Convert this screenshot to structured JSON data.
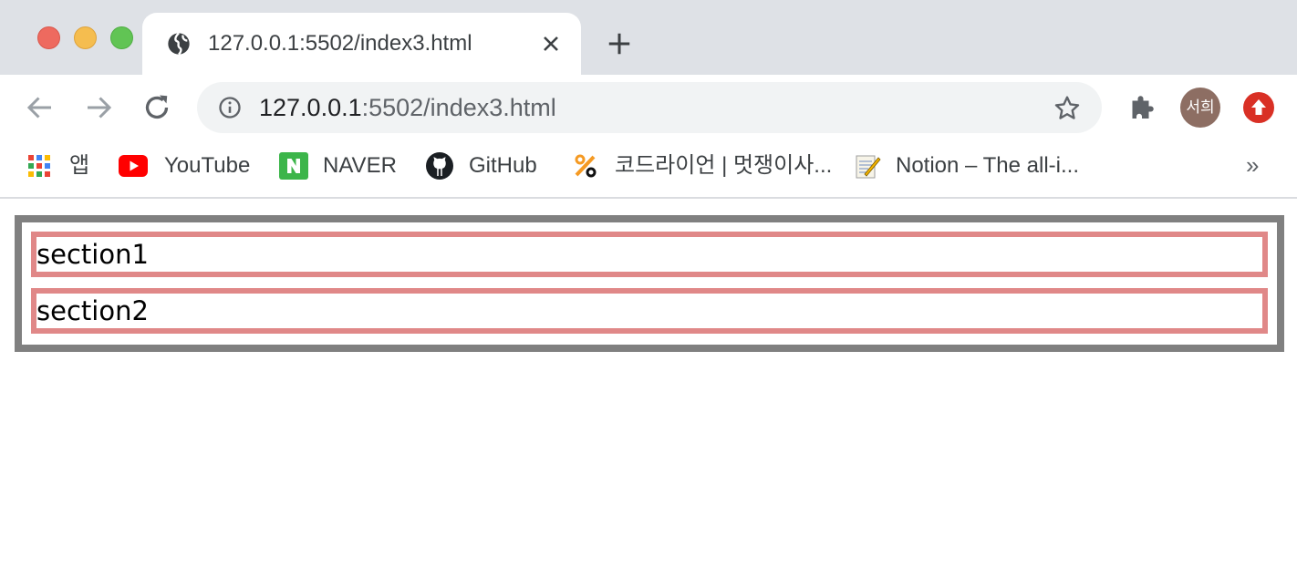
{
  "tab": {
    "title": "127.0.0.1:5502/index3.html"
  },
  "omnibox": {
    "url_host": "127.0.0.1",
    "url_path": ":5502/index3.html"
  },
  "profile": {
    "avatar_text": "서희"
  },
  "bookmarks": {
    "items": [
      {
        "label": "앱",
        "icon": "apps-grid-icon"
      },
      {
        "label": "YouTube",
        "icon": "youtube-icon"
      },
      {
        "label": "NAVER",
        "icon": "naver-icon"
      },
      {
        "label": "GitHub",
        "icon": "github-icon"
      },
      {
        "label": "코드라이언 | 멋쟁이사...",
        "icon": "codelion-icon"
      },
      {
        "label": "Notion – The all-i...",
        "icon": "notion-icon"
      }
    ],
    "overflow": "»"
  },
  "page": {
    "sections": [
      {
        "text": "section1"
      },
      {
        "text": "section2"
      }
    ]
  },
  "colors": {
    "outer_border": "#808080",
    "section_border": "#e08888",
    "tabstrip_bg": "#dee1e6"
  }
}
